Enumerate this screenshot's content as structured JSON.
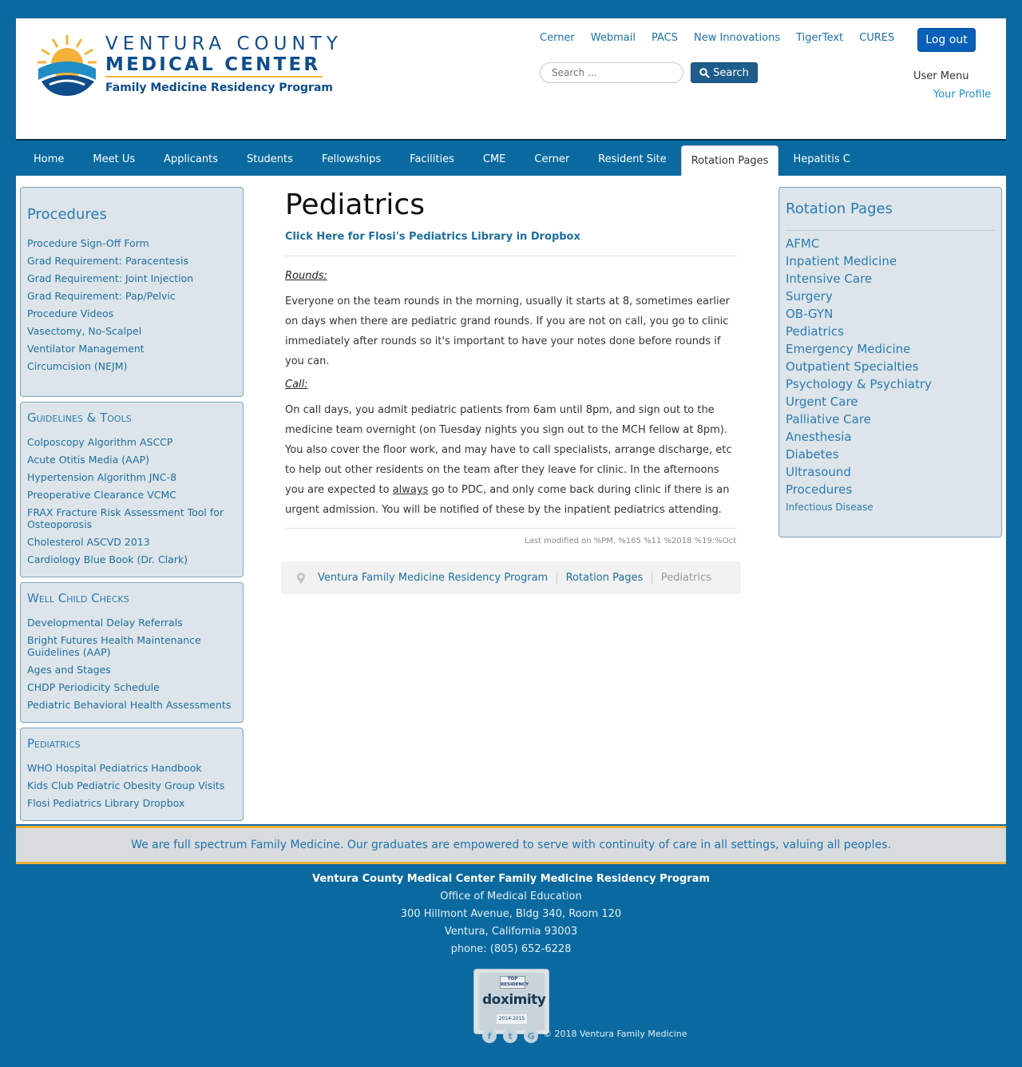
{
  "header": {
    "logo": {
      "line1": "VENTURA COUNTY",
      "line2": "MEDICAL CENTER",
      "line3": "Family Medicine Residency Program"
    },
    "top_links": [
      "Cerner",
      "Webmail",
      "PACS",
      "New Innovations",
      "TigerText",
      "CURES"
    ],
    "logout_label": "Log out",
    "search": {
      "placeholder": "Search ...",
      "button_label": "Search"
    },
    "user_menu_label": "User Menu",
    "your_profile_label": "Your Profile"
  },
  "nav": {
    "items": [
      "Home",
      "Meet Us",
      "Applicants",
      "Students",
      "Fellowships",
      "Facilities",
      "CME",
      "Cerner",
      "Resident Site",
      "Rotation Pages",
      "Hepatitis C"
    ],
    "active": "Rotation Pages"
  },
  "left_sidebar": {
    "procedures": {
      "title": "Procedures",
      "items": [
        "Procedure Sign-Off Form",
        "Grad Requirement: Paracentesis",
        "Grad Requirement: Joint Injection",
        "Grad Requirement: Pap/Pelvic",
        "Procedure Videos",
        "Vasectomy, No-Scalpel",
        "Ventilator Management",
        "Circumcision (NEJM)"
      ]
    },
    "guidelines": {
      "title": "Guidelines & Tools",
      "items": [
        "Colposcopy Algorithm ASCCP",
        "Acute Otitis Media (AAP)",
        "Hypertension Algorithm JNC-8",
        "Preoperative Clearance VCMC",
        "FRAX Fracture Risk Assessment Tool for Osteoporosis",
        "Cholesterol ASCVD 2013",
        "Cardiology Blue Book (Dr. Clark)"
      ]
    },
    "well_child": {
      "title": "Well Child Checks",
      "items": [
        "Developmental Delay Referrals",
        "Bright Futures Health Maintenance Guidelines (AAP)",
        "Ages and Stages",
        "CHDP Periodicity Schedule",
        "Pediatric Behavioral Health Assessments"
      ]
    },
    "pediatrics": {
      "title": "Pediatrics",
      "items": [
        "WHO Hospital Pediatrics Handbook",
        "Kids Club Pediatric Obesity Group Visits",
        "Flosi Pediatrics Library Dropbox"
      ]
    }
  },
  "main": {
    "title": "Pediatrics",
    "dropbox_link": "Click Here for Flosi's Pediatrics Library in Dropbox",
    "rounds_label": "Rounds:",
    "rounds_text": "Everyone on the team rounds in the morning, usually it starts at 8, sometimes earlier on days when there are pediatric grand rounds.  If you are not on call, you go to clinic immediately after rounds so it's important to have your notes done before rounds if you can.",
    "call_label": "Call:",
    "call_text_1": "On call days, you admit pediatric patients from 6am until 8pm, and sign out to the medicine team overnight (on Tuesday nights you sign out to the MCH fellow at 8pm).  You also cover the floor work, and may have to call specialists, arrange discharge, etc to help out other residents on the team after they leave for clinic.  In the afternoons you are expected to ",
    "call_text_emph": "always",
    "call_text_2": " go to PDC, and only come back during clinic if there is an urgent admission.  You will be notified of these by the inpatient pediatrics attending.",
    "last_modified": "Last modified on %PM, %165 %11 %2018 %19:%Oct"
  },
  "breadcrumb": {
    "items": [
      "Ventura Family Medicine Residency Program",
      "Rotation Pages"
    ],
    "current": "Pediatrics"
  },
  "right_sidebar": {
    "title": "Rotation Pages",
    "items": [
      "AFMC",
      "Inpatient Medicine",
      "Intensive Care",
      "Surgery",
      "OB-GYN",
      "Pediatrics",
      "Emergency Medicine",
      "Outpatient Specialties",
      "Psychology & Psychiatry",
      "Urgent Care",
      "Palliative Care",
      "Anesthesia",
      "Diabetes",
      "Ultrasound",
      "Procedures",
      "Infectious Disease"
    ]
  },
  "mission": "We are full spectrum Family Medicine. Our graduates are empowered to serve with continuity of care in all settings, valuing all peoples.",
  "footer": {
    "name": "Ventura County Medical Center Family Medicine Residency Program",
    "office": "Office of Medical Education",
    "address1": "300 Hillmont Avenue, Bldg 340, Room 120",
    "address2": "Ventura, California 93003",
    "phone": "phone: (805) 652-6228",
    "badge": {
      "top": "TOP RESIDENCY",
      "name": "doximity",
      "years": "2014-2015"
    },
    "social": [
      "f",
      "t",
      "G"
    ],
    "copyright": "© 2018 Ventura Family Medicine"
  },
  "colors": {
    "background": "#0a6aa0",
    "accent": "#f4b23a",
    "link": "#1f6f9f",
    "sidebar_bg": "#dde5ea",
    "logout_button": "#0a5fb8"
  }
}
